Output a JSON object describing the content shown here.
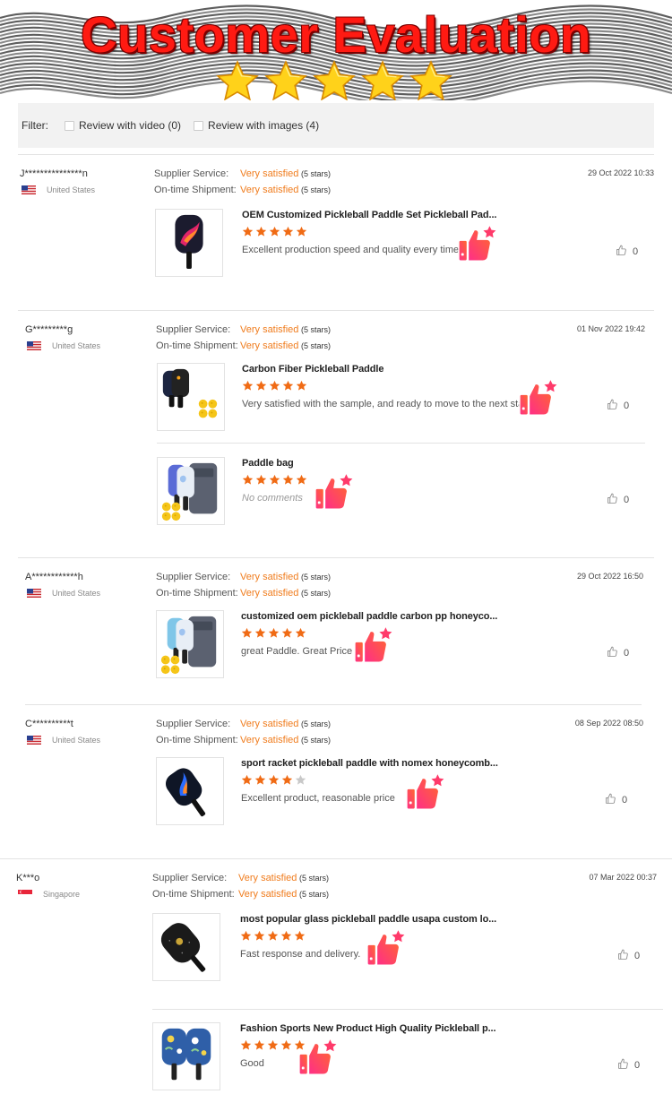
{
  "banner": {
    "title": "Customer Evaluation",
    "star_count": 5
  },
  "filter": {
    "label": "Filter:",
    "options": [
      {
        "label": "Review with video (0)"
      },
      {
        "label": "Review with images (4)"
      }
    ]
  },
  "labels": {
    "supplier_service": "Supplier Service:",
    "on_time_shipment": "On-time Shipment:",
    "very_satisfied": "Very satisfied",
    "five_stars": "(5 stars)"
  },
  "colors": {
    "accent_orange": "#f07c1d",
    "title_red": "#ff1a12",
    "star_orange": "#f06b15"
  },
  "reviews": [
    {
      "user": "J***************n",
      "country": "United States",
      "flag": "us-flag",
      "date": "29 Oct 2022 10:33",
      "products": [
        {
          "title": "OEM Customized Pickleball Paddle Set Pickleball Pad...",
          "stars": 5,
          "comment": "Excellent production speed and quality every time.",
          "likes": "0",
          "thumb": "red-flame-paddle"
        }
      ]
    },
    {
      "user": "G*********g",
      "country": "United States",
      "flag": "us-flag",
      "date": "01 Nov 2022 19:42",
      "products": [
        {
          "title": "Carbon Fiber Pickleball Paddle",
          "stars": 5,
          "comment": "Very satisfied with the sample, and ready to move to the next stage.",
          "likes": "0",
          "thumb": "carbon-paddles-balls"
        },
        {
          "title": "Paddle bag",
          "stars": 5,
          "comment": "No comments",
          "likes": "0",
          "thumb": "paddle-bag-set"
        }
      ]
    },
    {
      "user": "A************h",
      "country": "United States",
      "flag": "us-flag",
      "date": "29 Oct 2022 16:50",
      "products": [
        {
          "title": "customized oem pickleball paddle carbon pp honeyco...",
          "stars": 5,
          "comment": "great Paddle. Great Price",
          "likes": "0",
          "thumb": "paddle-bag-set-2"
        }
      ]
    },
    {
      "user": "C**********t",
      "country": "United States",
      "flag": "us-flag",
      "date": "08 Sep 2022 08:50",
      "products": [
        {
          "title": "sport racket pickleball paddle with nomex honeycomb...",
          "stars": 4,
          "comment": "Excellent product, reasonable price",
          "likes": "0",
          "thumb": "blue-flame-paddle"
        }
      ]
    },
    {
      "user": "K***o",
      "country": "Singapore",
      "flag": "sg-flag",
      "date": "07 Mar 2022 00:37",
      "products": [
        {
          "title": "most popular glass pickleball paddle usapa custom lo...",
          "stars": 5,
          "comment": "Fast response and delivery.",
          "likes": "0",
          "thumb": "black-glitter-paddle"
        },
        {
          "title": "Fashion Sports New Product High Quality Pickleball p...",
          "stars": 5,
          "comment": "Good",
          "likes": "0",
          "thumb": "floral-paddles"
        }
      ]
    }
  ]
}
